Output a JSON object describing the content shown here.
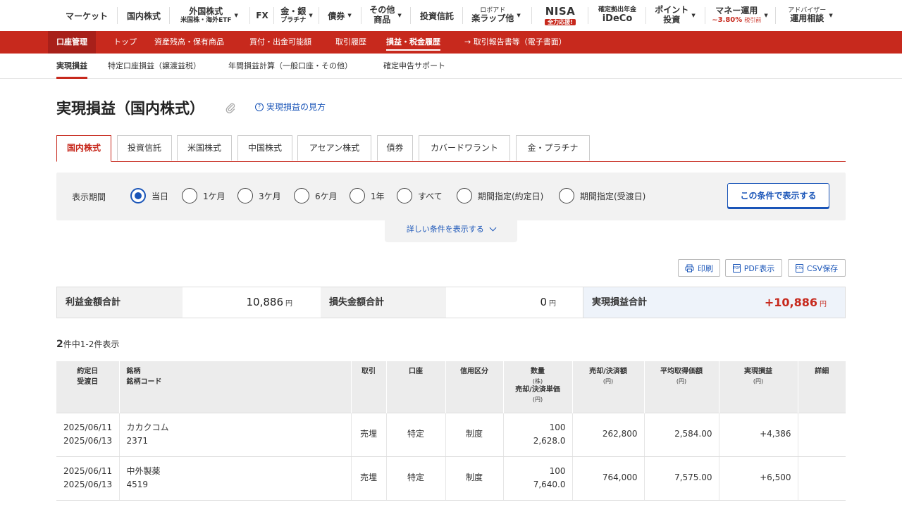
{
  "topnav": {
    "items": [
      {
        "label": "マーケット"
      },
      {
        "label": "国内株式"
      },
      {
        "main": "外国株式",
        "sub": "米国株・海外ETF"
      },
      {
        "label": "FX"
      },
      {
        "main": "金・銀",
        "sub": "プラチナ"
      },
      {
        "label": "債券"
      },
      {
        "main": "その他",
        "sub": "商品"
      },
      {
        "label": "投資信託"
      },
      {
        "sub": "ロボアド",
        "main": "楽ラップ他"
      },
      {
        "main": "NISA",
        "badge": "全力応援!"
      },
      {
        "sub": "確定拠出年金",
        "main": "iDeCo"
      },
      {
        "main": "ポイント",
        "sub": "投資"
      },
      {
        "main": "マネー運用",
        "rate": "~3.80%",
        "rate_note": "税引前"
      },
      {
        "sub": "アドバイザー",
        "main": "運用相談"
      }
    ]
  },
  "account_nav": {
    "items": [
      "口座管理",
      "トップ",
      "資産残高・保有商品",
      "買付・出金可能額",
      "取引履歴",
      "損益・税金履歴",
      "→ 取引報告書等（電子書面）"
    ]
  },
  "sub_nav": {
    "items": [
      "実現損益",
      "特定口座損益（譲渡益税）",
      "年間損益計算（一般口座・その他）",
      "確定申告サポート"
    ]
  },
  "page": {
    "title": "実現損益（国内株式）",
    "help_link": "実現損益の見方"
  },
  "tabs": [
    "国内株式",
    "投資信託",
    "米国株式",
    "中国株式",
    "アセアン株式",
    "債券",
    "カバードワラント",
    "金・プラチナ"
  ],
  "filter": {
    "label": "表示期間",
    "options": [
      "当日",
      "1ケ月",
      "3ケ月",
      "6ケ月",
      "1年",
      "すべて",
      "期間指定(約定日)",
      "期間指定(受渡日)"
    ],
    "selected": "当日",
    "submit": "この条件で表示する",
    "more": "詳しい条件を表示する"
  },
  "export": {
    "print": "印刷",
    "pdf": "PDF表示",
    "csv": "CSV保存"
  },
  "summary": {
    "profit_label": "利益金額合計",
    "profit_value": "10,886",
    "loss_label": "損失金額合計",
    "loss_value": "0",
    "total_label": "実現損益合計",
    "total_value": "+10,886",
    "yen": "円"
  },
  "result_count": {
    "count": "2",
    "text": "件中1-2件表示"
  },
  "table": {
    "headers": {
      "date": [
        "約定日",
        "受渡日"
      ],
      "name": [
        "銘柄",
        "銘柄コード"
      ],
      "trade": "取引",
      "account": "口座",
      "credit": "信用区分",
      "qty": [
        "数量",
        "(株)",
        "売却/決済単価",
        "(円)"
      ],
      "amount": [
        "売却/決済額",
        "(円)"
      ],
      "avg_cost": [
        "平均取得価額",
        "(円)"
      ],
      "pnl": [
        "実現損益",
        "(円)"
      ],
      "detail": "詳細"
    },
    "rows": [
      {
        "trade_date": "2025/06/11",
        "settle_date": "2025/06/13",
        "name": "カカクコム",
        "code": "2371",
        "trade": "売埋",
        "account": "特定",
        "credit": "制度",
        "qty": "100",
        "price": "2,628.0",
        "amount": "262,800",
        "avg_cost": "2,584.00",
        "pnl": "+4,386"
      },
      {
        "trade_date": "2025/06/11",
        "settle_date": "2025/06/13",
        "name": "中外製薬",
        "code": "4519",
        "trade": "売埋",
        "account": "特定",
        "credit": "制度",
        "qty": "100",
        "price": "7,640.0",
        "amount": "764,000",
        "avg_cost": "7,575.00",
        "pnl": "+6,500"
      }
    ]
  },
  "colors": {
    "brand_red": "#c7291d",
    "link_blue": "#1a55b8",
    "profit_red": "#e03c3c"
  }
}
